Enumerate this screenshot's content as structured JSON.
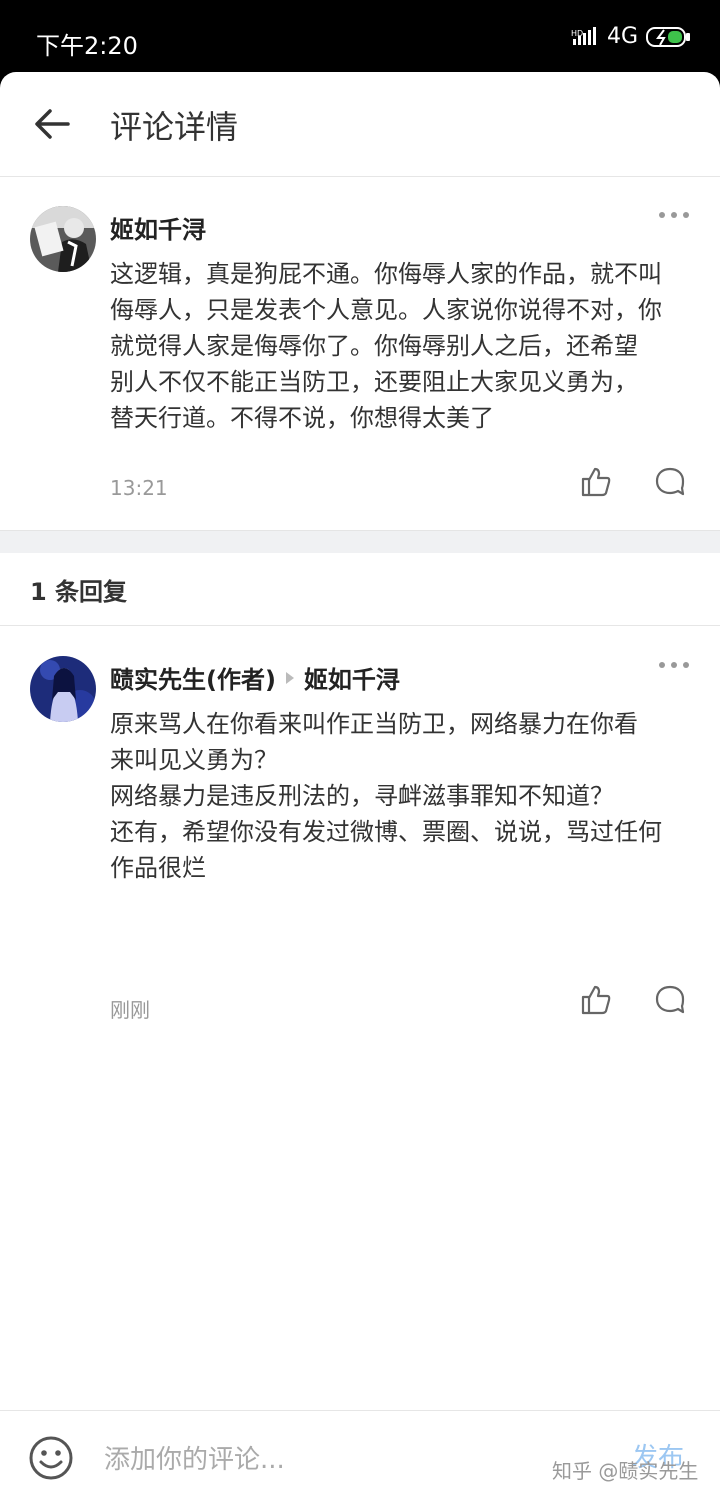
{
  "status_bar": {
    "time": "下午2:20",
    "network": "4G"
  },
  "header": {
    "title": "评论详情"
  },
  "main_comment": {
    "author": "姬如千浔",
    "text": "这逻辑，真是狗屁不通。你侮辱人家的作品，就不叫\n侮辱人，只是发表个人意见。人家说你说得不对，你\n就觉得人家是侮辱你了。你侮辱别人之后，还希望\n别人不仅不能正当防卫，还要阻止大家见义勇为，\n替天行道。不得不说，你想得太美了",
    "time": "13:21",
    "avatar_icon": "avatar-photo-man"
  },
  "replies_header": {
    "label": "1 条回复"
  },
  "reply": {
    "author": "赜实先生(作者)",
    "reply_to": "姬如千浔",
    "text": "原来骂人在你看来叫作正当防卫，网络暴力在你看\n来叫见义勇为？\n网络暴力是违反刑法的，寻衅滋事罪知不知道？\n还有，希望你没有发过微博、票圈、说说，骂过任何\n作品很烂",
    "time": "刚刚",
    "avatar_icon": "avatar-photo-woman"
  },
  "bottom_bar": {
    "placeholder": "添加你的评论...",
    "send": "发布",
    "watermark": "知乎 @赜实先生"
  },
  "colors": {
    "accent": "#9cc7f2",
    "text": "#333333",
    "meta": "#999999"
  }
}
